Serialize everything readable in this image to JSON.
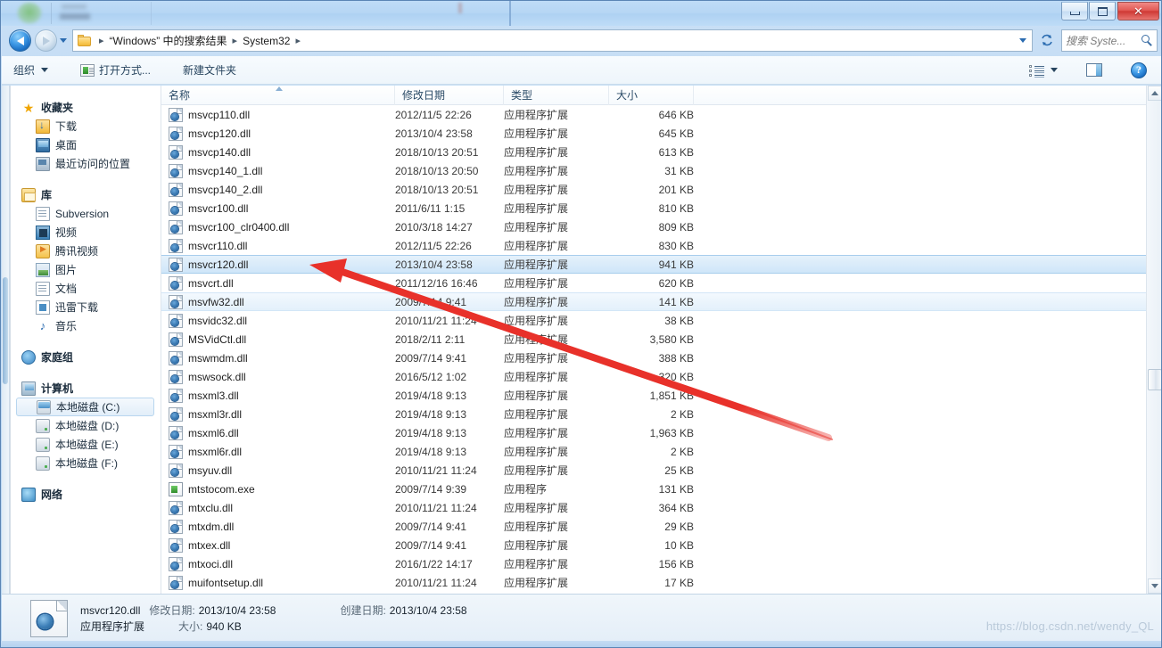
{
  "window": {
    "controls": {
      "minimize": "–",
      "maximize": "□",
      "close": "✕"
    }
  },
  "address": {
    "back_tooltip": "后退",
    "forward_tooltip": "前进",
    "crumbs": [
      "“Windows” 中的搜索结果",
      "System32"
    ],
    "separator": "▸"
  },
  "search": {
    "placeholder": "搜索 Syste...",
    "value": ""
  },
  "toolbar": {
    "organize": "组织",
    "open_with": "打开方式...",
    "new_folder": "新建文件夹",
    "help_glyph": "?"
  },
  "sidebar": {
    "groups": [
      {
        "head": {
          "label": "收藏夹",
          "icon": "star-icon"
        },
        "items": [
          {
            "label": "下载",
            "icon": "download-icon"
          },
          {
            "label": "桌面",
            "icon": "desktop-icon"
          },
          {
            "label": "最近访问的位置",
            "icon": "recent-places-icon"
          }
        ]
      },
      {
        "head": {
          "label": "库",
          "icon": "library-icon"
        },
        "items": [
          {
            "label": "Subversion",
            "icon": "document-icon"
          },
          {
            "label": "视频",
            "icon": "video-icon"
          },
          {
            "label": "腾讯视频",
            "icon": "tencent-video-icon"
          },
          {
            "label": "图片",
            "icon": "pictures-icon"
          },
          {
            "label": "文档",
            "icon": "documents-icon"
          },
          {
            "label": "迅雷下载",
            "icon": "thunder-download-icon"
          },
          {
            "label": "音乐",
            "icon": "music-icon"
          }
        ]
      },
      {
        "head": {
          "label": "家庭组",
          "icon": "homegroup-icon"
        },
        "items": []
      },
      {
        "head": {
          "label": "计算机",
          "icon": "computer-icon"
        },
        "items": [
          {
            "label": "本地磁盘 (C:)",
            "icon": "drive-c-icon",
            "selected": true
          },
          {
            "label": "本地磁盘 (D:)",
            "icon": "drive-icon"
          },
          {
            "label": "本地磁盘 (E:)",
            "icon": "drive-icon"
          },
          {
            "label": "本地磁盘 (F:)",
            "icon": "drive-icon"
          }
        ]
      },
      {
        "head": {
          "label": "网络",
          "icon": "network-icon"
        },
        "items": []
      }
    ]
  },
  "filelist": {
    "columns": [
      "名称",
      "修改日期",
      "类型",
      "大小"
    ],
    "sort_column": "名称",
    "sort_direction": "ascending",
    "rows": [
      {
        "name": "msvcp110.dll",
        "date": "2012/11/5 22:26",
        "type": "应用程序扩展",
        "size": "646 KB",
        "icon": "dll-icon"
      },
      {
        "name": "msvcp120.dll",
        "date": "2013/10/4 23:58",
        "type": "应用程序扩展",
        "size": "645 KB",
        "icon": "dll-icon"
      },
      {
        "name": "msvcp140.dll",
        "date": "2018/10/13 20:51",
        "type": "应用程序扩展",
        "size": "613 KB",
        "icon": "dll-icon"
      },
      {
        "name": "msvcp140_1.dll",
        "date": "2018/10/13 20:50",
        "type": "应用程序扩展",
        "size": "31 KB",
        "icon": "dll-icon"
      },
      {
        "name": "msvcp140_2.dll",
        "date": "2018/10/13 20:51",
        "type": "应用程序扩展",
        "size": "201 KB",
        "icon": "dll-icon"
      },
      {
        "name": "msvcr100.dll",
        "date": "2011/6/11 1:15",
        "type": "应用程序扩展",
        "size": "810 KB",
        "icon": "dll-icon"
      },
      {
        "name": "msvcr100_clr0400.dll",
        "date": "2010/3/18 14:27",
        "type": "应用程序扩展",
        "size": "809 KB",
        "icon": "dll-icon"
      },
      {
        "name": "msvcr110.dll",
        "date": "2012/11/5 22:26",
        "type": "应用程序扩展",
        "size": "830 KB",
        "icon": "dll-icon"
      },
      {
        "name": "msvcr120.dll",
        "date": "2013/10/4 23:58",
        "type": "应用程序扩展",
        "size": "941 KB",
        "icon": "dll-icon",
        "state": "selected"
      },
      {
        "name": "msvcrt.dll",
        "date": "2011/12/16 16:46",
        "type": "应用程序扩展",
        "size": "620 KB",
        "icon": "dll-icon"
      },
      {
        "name": "msvfw32.dll",
        "date": "2009/7/14 9:41",
        "type": "应用程序扩展",
        "size": "141 KB",
        "icon": "dll-icon",
        "state": "hover"
      },
      {
        "name": "msvidc32.dll",
        "date": "2010/11/21 11:24",
        "type": "应用程序扩展",
        "size": "38 KB",
        "icon": "dll-icon"
      },
      {
        "name": "MSVidCtl.dll",
        "date": "2018/2/11 2:11",
        "type": "应用程序扩展",
        "size": "3,580 KB",
        "icon": "dll-icon"
      },
      {
        "name": "mswmdm.dll",
        "date": "2009/7/14 9:41",
        "type": "应用程序扩展",
        "size": "388 KB",
        "icon": "dll-icon"
      },
      {
        "name": "mswsock.dll",
        "date": "2016/5/12 1:02",
        "type": "应用程序扩展",
        "size": "320 KB",
        "icon": "dll-icon"
      },
      {
        "name": "msxml3.dll",
        "date": "2019/4/18 9:13",
        "type": "应用程序扩展",
        "size": "1,851 KB",
        "icon": "dll-icon"
      },
      {
        "name": "msxml3r.dll",
        "date": "2019/4/18 9:13",
        "type": "应用程序扩展",
        "size": "2 KB",
        "icon": "dll-icon"
      },
      {
        "name": "msxml6.dll",
        "date": "2019/4/18 9:13",
        "type": "应用程序扩展",
        "size": "1,963 KB",
        "icon": "dll-icon"
      },
      {
        "name": "msxml6r.dll",
        "date": "2019/4/18 9:13",
        "type": "应用程序扩展",
        "size": "2 KB",
        "icon": "dll-icon"
      },
      {
        "name": "msyuv.dll",
        "date": "2010/11/21 11:24",
        "type": "应用程序扩展",
        "size": "25 KB",
        "icon": "dll-icon"
      },
      {
        "name": "mtstocom.exe",
        "date": "2009/7/14 9:39",
        "type": "应用程序",
        "size": "131 KB",
        "icon": "exe-icon"
      },
      {
        "name": "mtxclu.dll",
        "date": "2010/11/21 11:24",
        "type": "应用程序扩展",
        "size": "364 KB",
        "icon": "dll-icon"
      },
      {
        "name": "mtxdm.dll",
        "date": "2009/7/14 9:41",
        "type": "应用程序扩展",
        "size": "29 KB",
        "icon": "dll-icon"
      },
      {
        "name": "mtxex.dll",
        "date": "2009/7/14 9:41",
        "type": "应用程序扩展",
        "size": "10 KB",
        "icon": "dll-icon"
      },
      {
        "name": "mtxoci.dll",
        "date": "2016/1/22 14:17",
        "type": "应用程序扩展",
        "size": "156 KB",
        "icon": "dll-icon"
      },
      {
        "name": "muifontsetup.dll",
        "date": "2010/11/21 11:24",
        "type": "应用程序扩展",
        "size": "17 KB",
        "icon": "dll-icon"
      }
    ]
  },
  "details": {
    "filename": "msvcr120.dll",
    "modified_label": "修改日期:",
    "modified_value": "2013/10/4 23:58",
    "created_label": "创建日期:",
    "created_value": "2013/10/4 23:58",
    "type": "应用程序扩展",
    "size_label": "大小:",
    "size_value": "940 KB"
  },
  "annotation": {
    "color": "#e8312a",
    "watermark": "https://blog.csdn.net/wendy_QL"
  }
}
